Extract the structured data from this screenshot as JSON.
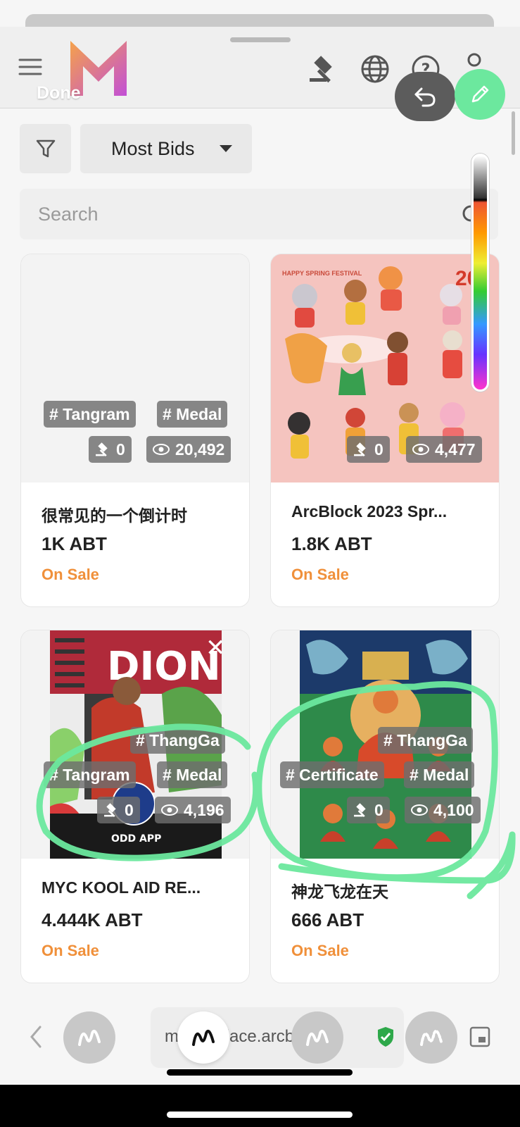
{
  "header": {
    "done_label": "Done",
    "icons": [
      "menu-icon",
      "auction-icon",
      "globe-icon",
      "help-icon",
      "user-icon"
    ]
  },
  "toolbar": {
    "sort_label": "Most Bids",
    "search_placeholder": "Search"
  },
  "cards": [
    {
      "tags_row1": [
        "# Tangram",
        "# Medal"
      ],
      "bids": "0",
      "views": "20,492",
      "title": "很常见的一个倒计时",
      "price": "1K ABT",
      "status": "On Sale"
    },
    {
      "poster_caption": "HAPPY SPRING FESTIVAL",
      "poster_year": "20",
      "bids": "0",
      "views": "4,477",
      "title": "ArcBlock 2023 Spr...",
      "price": "1.8K ABT",
      "status": "On Sale"
    },
    {
      "poster_word": "DION",
      "poster_logo": "ODD APP",
      "tag_top": "# ThangGa",
      "tags_row": [
        "# Tangram",
        "# Medal"
      ],
      "bids": "0",
      "views": "4,196",
      "title": "MYC KOOL AID RE...",
      "price": "4.444K ABT",
      "status": "On Sale"
    },
    {
      "tag_top": "# ThangGa",
      "tags_row": [
        "# Certificate",
        "# Medal"
      ],
      "bids": "0",
      "views": "4,100",
      "title": "神龙飞龙在天",
      "price": "666 ABT",
      "status": "On Sale"
    }
  ],
  "browser": {
    "url": "marketplace.arcblock.io"
  },
  "colors": {
    "accent_orange": "#f0903a",
    "annotation_green": "#6ce89e",
    "tag_bg": "#6e6e6e"
  }
}
